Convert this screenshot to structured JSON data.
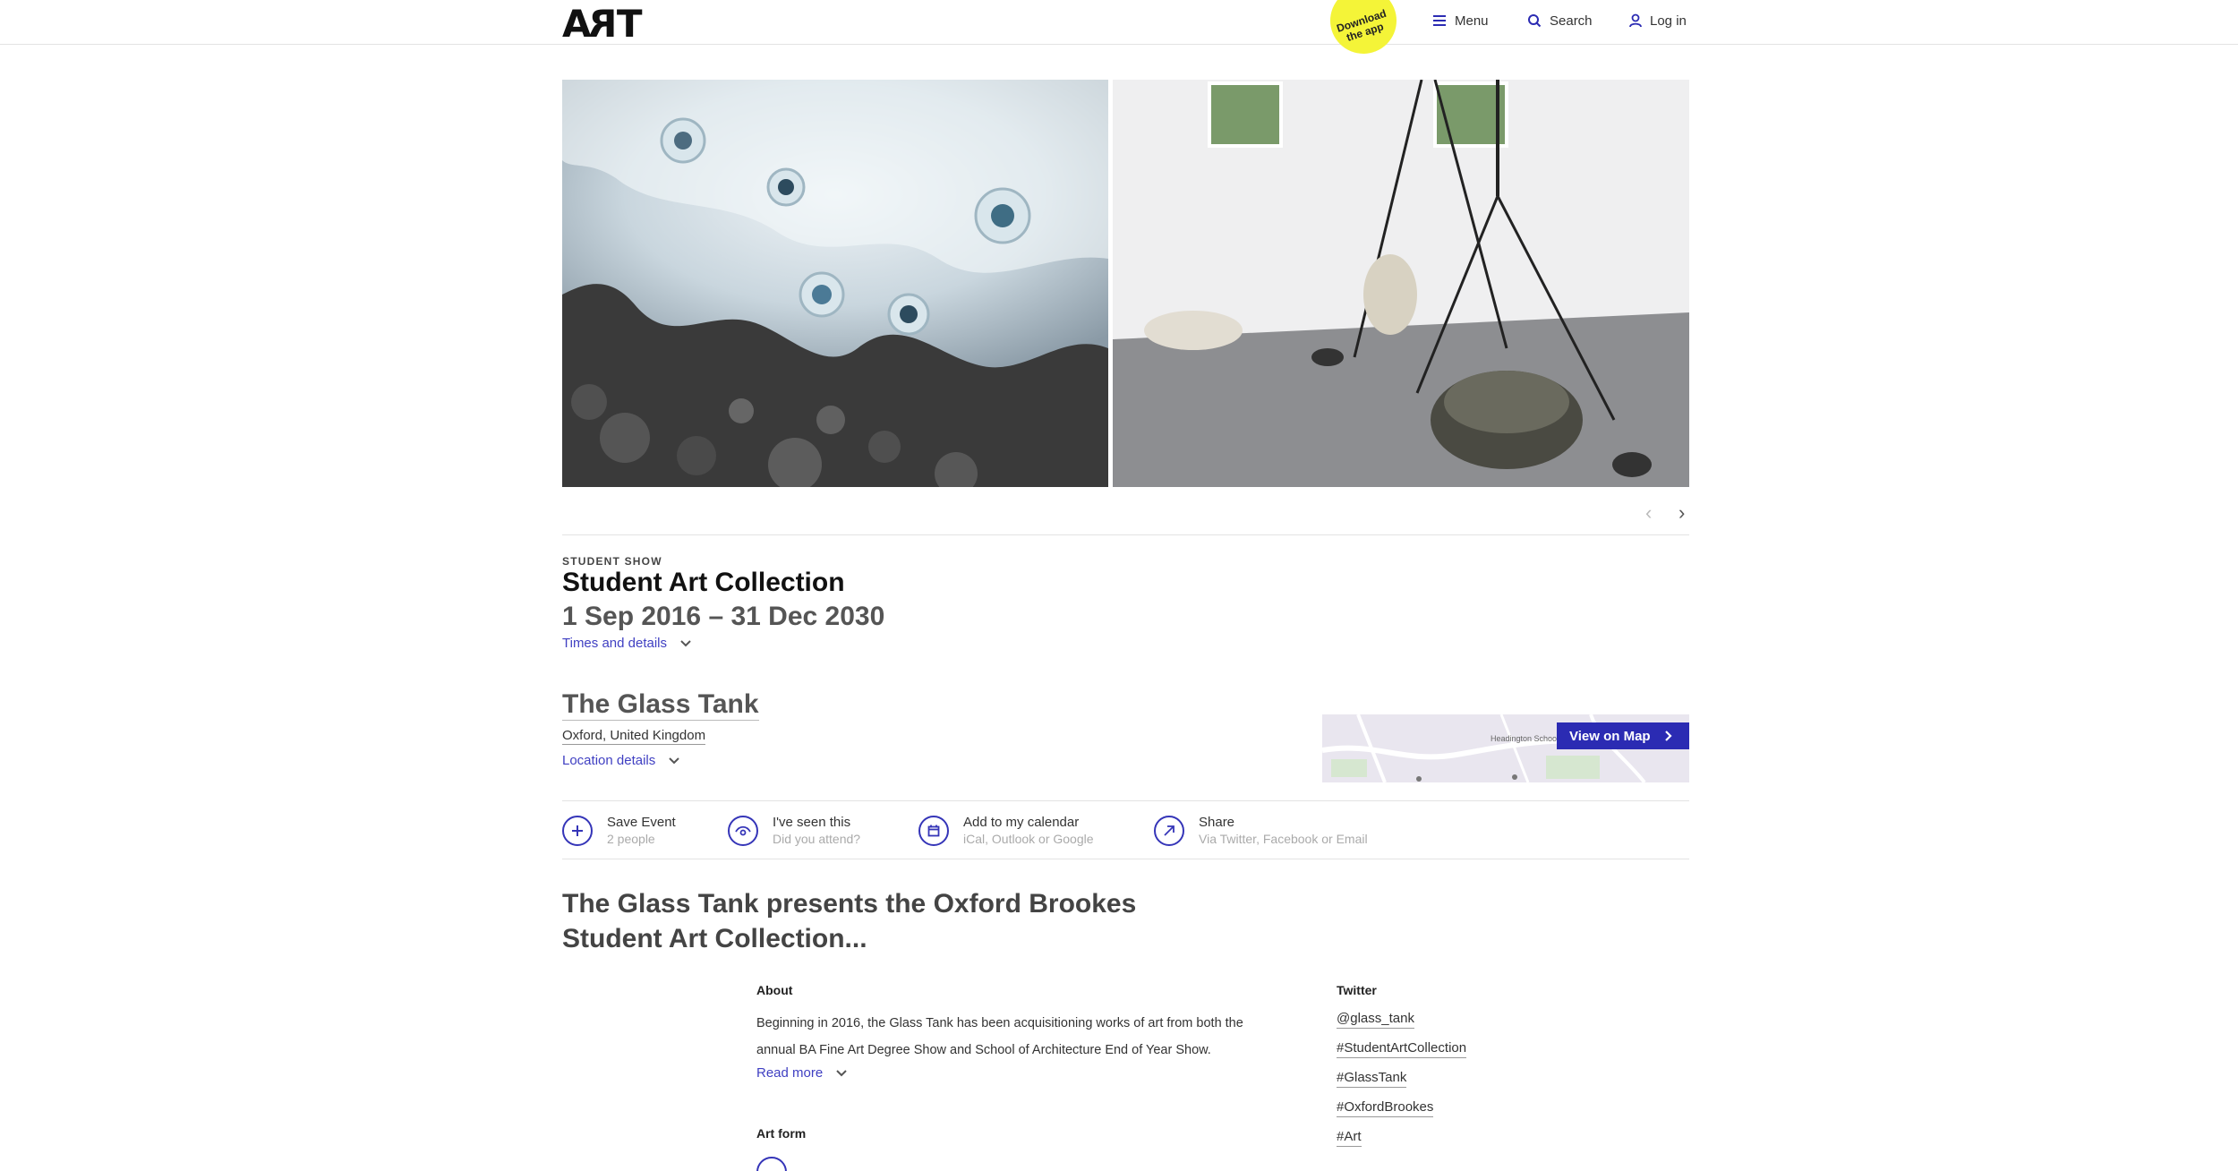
{
  "header": {
    "logo": "ART",
    "app_badge": "Download the app",
    "menu": "Menu",
    "search": "Search",
    "login": "Log in"
  },
  "event": {
    "category": "STUDENT SHOW",
    "title": "Student Art Collection",
    "dates": "1 Sep 2016 – 31 Dec 2030",
    "times_link": "Times and details"
  },
  "venue": {
    "name": "The Glass Tank",
    "city": "Oxford, United Kingdom",
    "location_link": "Location details",
    "map_button": "View on Map",
    "map_label": "Headington School"
  },
  "actions": [
    {
      "title": "Save Event",
      "subtitle": "2 people",
      "icon": "plus-icon"
    },
    {
      "title": "I've seen this",
      "subtitle": "Did you attend?",
      "icon": "eye-icon"
    },
    {
      "title": "Add to my calendar",
      "subtitle": "iCal, Outlook or Google",
      "icon": "calendar-icon"
    },
    {
      "title": "Share",
      "subtitle": "Via Twitter, Facebook or Email",
      "icon": "arrow-up-right-icon"
    }
  ],
  "headline": "The Glass Tank presents the Oxford Brookes Student Art Collection...",
  "about": {
    "label": "About",
    "text": "Beginning in 2016, the Glass Tank has been acquisitioning works of art from both the annual BA Fine Art Degree Show and School of Architecture End of Year Show.",
    "read_more": "Read more"
  },
  "twitter": {
    "label": "Twitter",
    "handles": [
      "@glass_tank",
      "#StudentArtCollection",
      "#GlassTank",
      "#OxfordBrookes",
      "#Art"
    ]
  },
  "art_form": {
    "label": "Art form"
  },
  "colors": {
    "accent": "#3f3fc2",
    "badge": "#f4f438",
    "map_button": "#2b2bb3"
  }
}
